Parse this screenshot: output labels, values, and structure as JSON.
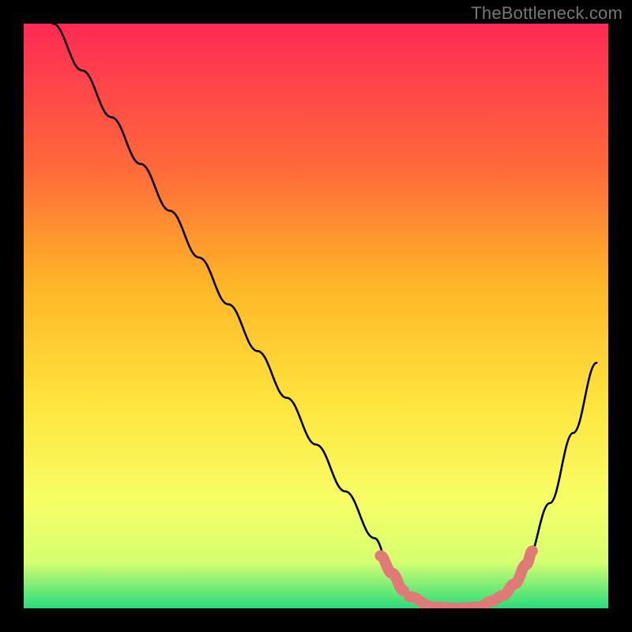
{
  "attribution": "TheBottleneck.com",
  "colors": {
    "black": "#000000",
    "curve": "#000000",
    "highlight": "#e07a78",
    "grad_top": "#ff2a55",
    "grad_mid1": "#ff6a3a",
    "grad_mid2": "#ffb727",
    "grad_mid3": "#ffe43e",
    "grad_mid4": "#f6ff66",
    "grad_mid5": "#d6ff70",
    "grad_bottom": "#2bdc7a"
  },
  "chart_data": {
    "type": "line",
    "title": "",
    "xlabel": "",
    "ylabel": "",
    "xlim": [
      0,
      100
    ],
    "ylim": [
      0,
      100
    ],
    "series": [
      {
        "name": "bottleneck-curve",
        "x": [
          5,
          10,
          15,
          20,
          25,
          30,
          35,
          40,
          45,
          50,
          55,
          60,
          63,
          66,
          70,
          74,
          78,
          82,
          86,
          90,
          94,
          98
        ],
        "values": [
          100,
          92,
          84,
          76,
          68,
          60,
          52,
          44,
          36,
          28,
          20,
          12,
          6,
          2,
          0,
          0,
          0,
          2,
          8,
          18,
          30,
          42
        ]
      }
    ],
    "highlight_segments": [
      {
        "x": [
          61,
          63,
          65
        ],
        "values": [
          9,
          6,
          3
        ]
      },
      {
        "x": [
          66,
          70,
          74,
          78,
          80
        ],
        "values": [
          2,
          0.2,
          0,
          0.2,
          1.2
        ]
      },
      {
        "x": [
          80,
          82,
          84,
          86,
          87
        ],
        "values": [
          1.2,
          2.2,
          4.2,
          7.5,
          9.8
        ]
      }
    ]
  }
}
